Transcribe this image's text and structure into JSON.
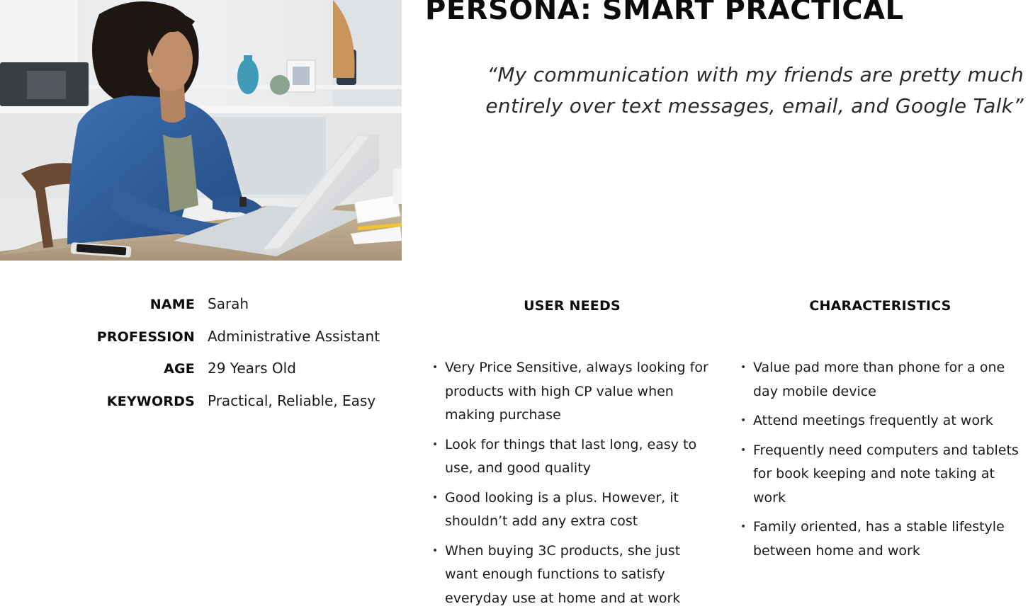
{
  "title": "PERSONA: SMART PRACTICAL",
  "quote": {
    "line1": "“My communication with my friends are pretty much",
    "line2": "entirely over text messages, email, and Google Talk”"
  },
  "profile": [
    {
      "label": "NAME",
      "value": "Sarah"
    },
    {
      "label": "PROFESSION",
      "value": "Administrative Assistant"
    },
    {
      "label": "AGE",
      "value": "29 Years Old"
    },
    {
      "label": "KEYWORDS",
      "value": "Practical, Reliable, Easy"
    }
  ],
  "user_needs": {
    "heading": "USER NEEDS",
    "items": [
      "Very Price Sensitive, always looking for products with high CP value when making purchase",
      "Look for things that last long, easy to use, and good quality",
      "Good looking is a plus. However, it shouldn’t add any extra cost",
      "When buying 3C products, she just want enough functions to satisfy everyday use at home and at work"
    ]
  },
  "characteristics": {
    "heading": "CHARACTERISTICS",
    "items": [
      "Value pad more than phone for a one day mobile device",
      "Attend meetings frequently at work",
      "Frequently need computers and tablets for book keeping and note taking at work",
      "Family oriented, has a stable lifestyle between home and work"
    ]
  },
  "colors": {
    "text": "#111111",
    "shirt": "#2f5f9e",
    "laptop": "#d9dcdf"
  }
}
